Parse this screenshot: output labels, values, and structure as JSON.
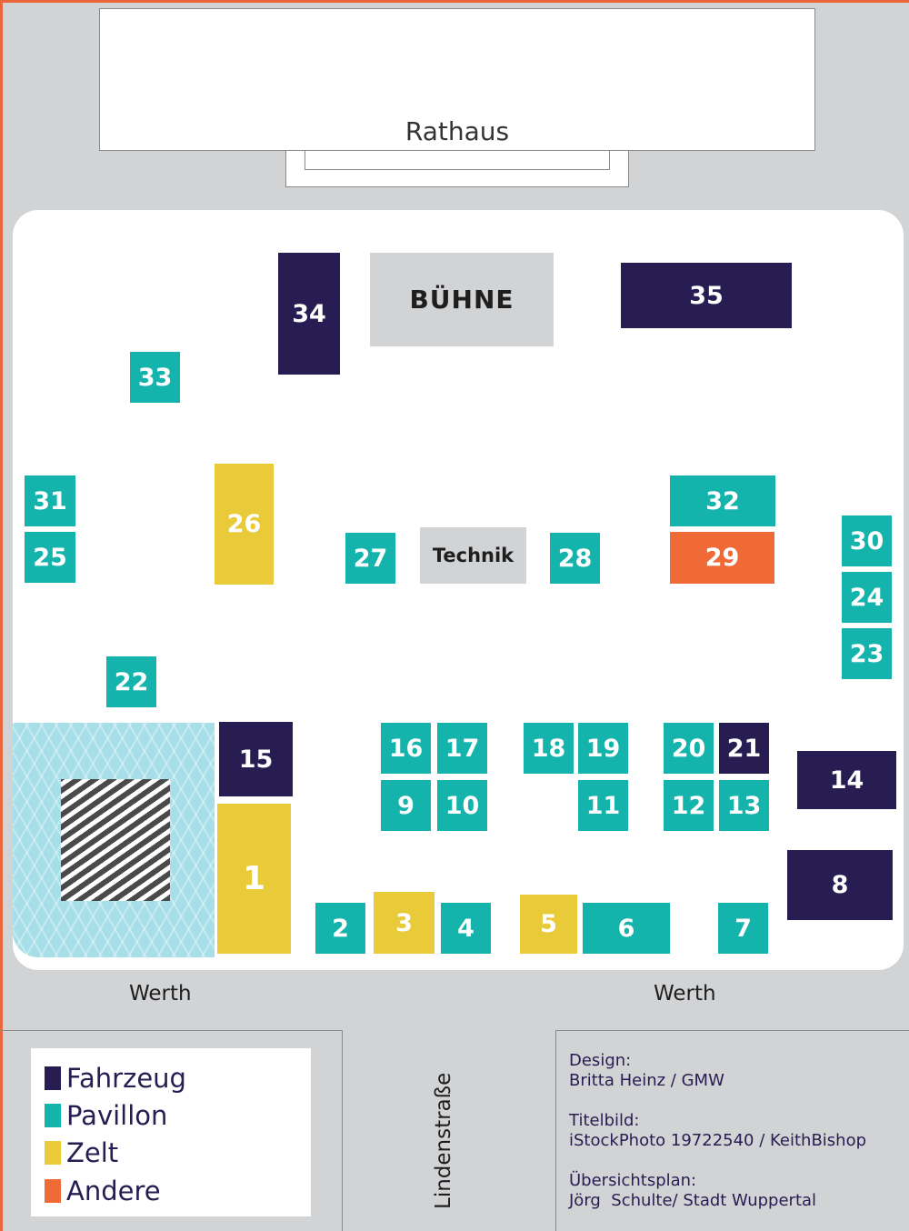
{
  "colors": {
    "fahrzeug": "#271d52",
    "pavillon": "#14b3ac",
    "zelt": "#e9cb3a",
    "andere": "#ef6a37",
    "ground": "#d2d3d5",
    "border": "#e8663a"
  },
  "buildings": {
    "rathaus": "Rathaus"
  },
  "stage": {
    "buhne": "BÜHNE",
    "technik": "Technik"
  },
  "stands": [
    {
      "label": "34",
      "type": "fahrzeug"
    },
    {
      "label": "35",
      "type": "fahrzeug"
    },
    {
      "label": "33",
      "type": "pavillon"
    },
    {
      "label": "31",
      "type": "pavillon"
    },
    {
      "label": "25",
      "type": "pavillon"
    },
    {
      "label": "26",
      "type": "zelt"
    },
    {
      "label": "27",
      "type": "pavillon"
    },
    {
      "label": "28",
      "type": "pavillon"
    },
    {
      "label": "32",
      "type": "pavillon"
    },
    {
      "label": "29",
      "type": "andere"
    },
    {
      "label": "30",
      "type": "pavillon"
    },
    {
      "label": "24",
      "type": "pavillon"
    },
    {
      "label": "23",
      "type": "pavillon"
    },
    {
      "label": "22",
      "type": "pavillon"
    },
    {
      "label": "15",
      "type": "fahrzeug"
    },
    {
      "label": "1",
      "type": "zelt"
    },
    {
      "label": "16",
      "type": "pavillon"
    },
    {
      "label": "17",
      "type": "pavillon"
    },
    {
      "label": "9",
      "type": "pavillon"
    },
    {
      "label": "10",
      "type": "pavillon"
    },
    {
      "label": "18",
      "type": "pavillon"
    },
    {
      "label": "19",
      "type": "pavillon"
    },
    {
      "label": "11",
      "type": "pavillon"
    },
    {
      "label": "20",
      "type": "pavillon"
    },
    {
      "label": "21",
      "type": "fahrzeug"
    },
    {
      "label": "12",
      "type": "pavillon"
    },
    {
      "label": "13",
      "type": "pavillon"
    },
    {
      "label": "14",
      "type": "fahrzeug"
    },
    {
      "label": "8",
      "type": "fahrzeug"
    },
    {
      "label": "2",
      "type": "pavillon"
    },
    {
      "label": "3",
      "type": "zelt"
    },
    {
      "label": "4",
      "type": "pavillon"
    },
    {
      "label": "5",
      "type": "zelt"
    },
    {
      "label": "6",
      "type": "pavillon"
    },
    {
      "label": "7",
      "type": "pavillon"
    }
  ],
  "streets": {
    "werth_left": "Werth",
    "werth_right": "Werth",
    "lindenstrasse": "Lindenstraße"
  },
  "legend": [
    {
      "label": "Fahrzeug",
      "color": "#271d52"
    },
    {
      "label": "Pavillon",
      "color": "#14b3ac"
    },
    {
      "label": "Zelt",
      "color": "#e9cb3a"
    },
    {
      "label": "Andere",
      "color": "#ef6a37"
    }
  ],
  "credits": {
    "design_title": "Design:",
    "design_name": "Britta Heinz / GMW",
    "titelbild_title": "Titelbild:",
    "titelbild_name": "iStockPhoto 19722540 / KeithBishop",
    "plan_title": "Übersichtsplan:",
    "plan_name": "Jörg  Schulte/ Stadt Wuppertal"
  }
}
